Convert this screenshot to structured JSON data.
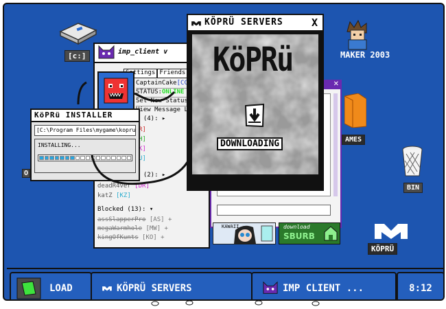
{
  "desktop": {
    "icons": {
      "drive_label": "[c:]",
      "maker_label": "MAKER 2003",
      "games_label": "AMES",
      "bin_label": "BIN",
      "kopru_label": "KÖPRÜ",
      "partial_left_label": "O"
    }
  },
  "imp_client": {
    "title": "imp_client v",
    "tabs": [
      "Settings",
      "Friends",
      "Bl"
    ],
    "username": "CaptainCake",
    "username_tag": "[CC]",
    "status_label": "STATUS:",
    "status_value": "ONLINE",
    "set_status": "Set New Status",
    "view_messages": "View Message Lo",
    "group1_header": "e (4):",
    "group1_tags": [
      "R]",
      "H]",
      "K]",
      "U]"
    ],
    "group2_header": "e (2):",
    "group2_items": [
      {
        "name": "deadR4ver",
        "tag": "[DR]"
      },
      {
        "name": "katZ",
        "tag": "[KZ]"
      }
    ],
    "blocked_header": "Blocked (13):",
    "blocked_items": [
      {
        "name": "assSlapperPro",
        "tag": "[AS] +"
      },
      {
        "name": "megaWarmhole",
        "tag": "[MW] +"
      },
      {
        "name": "kingOfKunts",
        "tag": "[KO] +"
      }
    ]
  },
  "installer": {
    "title": "KöPRü INSTALLER",
    "path": "[C:\\Program Files\\mygame\\kopru]",
    "status": "INSTALLING...",
    "progress": 0.4
  },
  "kopru_servers": {
    "title": "KÖPRÜ SERVERS",
    "close": "X",
    "logo_text": "KöPRü",
    "download_status": "DOWNLOADING"
  },
  "ads": {
    "kawaii": "KAWAII",
    "download_line1": "download",
    "download_line2": "SBURB"
  },
  "taskbar": {
    "load_label": "LOAD",
    "servers_label": "KÖPRÜ SERVERS",
    "imp_label": "IMP CLIENT ...",
    "clock": "8:12"
  },
  "colors": {
    "desktop": "#1d55b0",
    "online": "#22dd22",
    "tag_blue": "#2244cc",
    "tag_cyan": "#22aacc",
    "tag_magenta": "#cc22cc",
    "tag_red": "#cc2222",
    "tag_green": "#22aa22",
    "accent_purple": "#6a2ab0"
  }
}
